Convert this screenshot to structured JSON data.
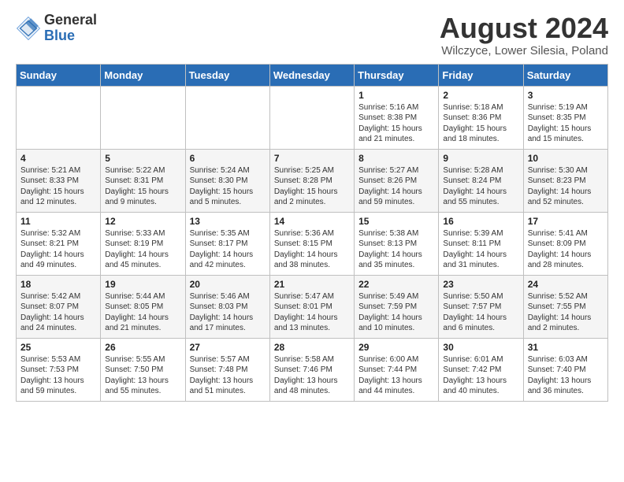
{
  "logo": {
    "general": "General",
    "blue": "Blue"
  },
  "title": "August 2024",
  "location": "Wilczyce, Lower Silesia, Poland",
  "days_of_week": [
    "Sunday",
    "Monday",
    "Tuesday",
    "Wednesday",
    "Thursday",
    "Friday",
    "Saturday"
  ],
  "weeks": [
    [
      {
        "day": "",
        "info": ""
      },
      {
        "day": "",
        "info": ""
      },
      {
        "day": "",
        "info": ""
      },
      {
        "day": "",
        "info": ""
      },
      {
        "day": "1",
        "info": "Sunrise: 5:16 AM\nSunset: 8:38 PM\nDaylight: 15 hours\nand 21 minutes."
      },
      {
        "day": "2",
        "info": "Sunrise: 5:18 AM\nSunset: 8:36 PM\nDaylight: 15 hours\nand 18 minutes."
      },
      {
        "day": "3",
        "info": "Sunrise: 5:19 AM\nSunset: 8:35 PM\nDaylight: 15 hours\nand 15 minutes."
      }
    ],
    [
      {
        "day": "4",
        "info": "Sunrise: 5:21 AM\nSunset: 8:33 PM\nDaylight: 15 hours\nand 12 minutes."
      },
      {
        "day": "5",
        "info": "Sunrise: 5:22 AM\nSunset: 8:31 PM\nDaylight: 15 hours\nand 9 minutes."
      },
      {
        "day": "6",
        "info": "Sunrise: 5:24 AM\nSunset: 8:30 PM\nDaylight: 15 hours\nand 5 minutes."
      },
      {
        "day": "7",
        "info": "Sunrise: 5:25 AM\nSunset: 8:28 PM\nDaylight: 15 hours\nand 2 minutes."
      },
      {
        "day": "8",
        "info": "Sunrise: 5:27 AM\nSunset: 8:26 PM\nDaylight: 14 hours\nand 59 minutes."
      },
      {
        "day": "9",
        "info": "Sunrise: 5:28 AM\nSunset: 8:24 PM\nDaylight: 14 hours\nand 55 minutes."
      },
      {
        "day": "10",
        "info": "Sunrise: 5:30 AM\nSunset: 8:23 PM\nDaylight: 14 hours\nand 52 minutes."
      }
    ],
    [
      {
        "day": "11",
        "info": "Sunrise: 5:32 AM\nSunset: 8:21 PM\nDaylight: 14 hours\nand 49 minutes."
      },
      {
        "day": "12",
        "info": "Sunrise: 5:33 AM\nSunset: 8:19 PM\nDaylight: 14 hours\nand 45 minutes."
      },
      {
        "day": "13",
        "info": "Sunrise: 5:35 AM\nSunset: 8:17 PM\nDaylight: 14 hours\nand 42 minutes."
      },
      {
        "day": "14",
        "info": "Sunrise: 5:36 AM\nSunset: 8:15 PM\nDaylight: 14 hours\nand 38 minutes."
      },
      {
        "day": "15",
        "info": "Sunrise: 5:38 AM\nSunset: 8:13 PM\nDaylight: 14 hours\nand 35 minutes."
      },
      {
        "day": "16",
        "info": "Sunrise: 5:39 AM\nSunset: 8:11 PM\nDaylight: 14 hours\nand 31 minutes."
      },
      {
        "day": "17",
        "info": "Sunrise: 5:41 AM\nSunset: 8:09 PM\nDaylight: 14 hours\nand 28 minutes."
      }
    ],
    [
      {
        "day": "18",
        "info": "Sunrise: 5:42 AM\nSunset: 8:07 PM\nDaylight: 14 hours\nand 24 minutes."
      },
      {
        "day": "19",
        "info": "Sunrise: 5:44 AM\nSunset: 8:05 PM\nDaylight: 14 hours\nand 21 minutes."
      },
      {
        "day": "20",
        "info": "Sunrise: 5:46 AM\nSunset: 8:03 PM\nDaylight: 14 hours\nand 17 minutes."
      },
      {
        "day": "21",
        "info": "Sunrise: 5:47 AM\nSunset: 8:01 PM\nDaylight: 14 hours\nand 13 minutes."
      },
      {
        "day": "22",
        "info": "Sunrise: 5:49 AM\nSunset: 7:59 PM\nDaylight: 14 hours\nand 10 minutes."
      },
      {
        "day": "23",
        "info": "Sunrise: 5:50 AM\nSunset: 7:57 PM\nDaylight: 14 hours\nand 6 minutes."
      },
      {
        "day": "24",
        "info": "Sunrise: 5:52 AM\nSunset: 7:55 PM\nDaylight: 14 hours\nand 2 minutes."
      }
    ],
    [
      {
        "day": "25",
        "info": "Sunrise: 5:53 AM\nSunset: 7:53 PM\nDaylight: 13 hours\nand 59 minutes."
      },
      {
        "day": "26",
        "info": "Sunrise: 5:55 AM\nSunset: 7:50 PM\nDaylight: 13 hours\nand 55 minutes."
      },
      {
        "day": "27",
        "info": "Sunrise: 5:57 AM\nSunset: 7:48 PM\nDaylight: 13 hours\nand 51 minutes."
      },
      {
        "day": "28",
        "info": "Sunrise: 5:58 AM\nSunset: 7:46 PM\nDaylight: 13 hours\nand 48 minutes."
      },
      {
        "day": "29",
        "info": "Sunrise: 6:00 AM\nSunset: 7:44 PM\nDaylight: 13 hours\nand 44 minutes."
      },
      {
        "day": "30",
        "info": "Sunrise: 6:01 AM\nSunset: 7:42 PM\nDaylight: 13 hours\nand 40 minutes."
      },
      {
        "day": "31",
        "info": "Sunrise: 6:03 AM\nSunset: 7:40 PM\nDaylight: 13 hours\nand 36 minutes."
      }
    ]
  ]
}
